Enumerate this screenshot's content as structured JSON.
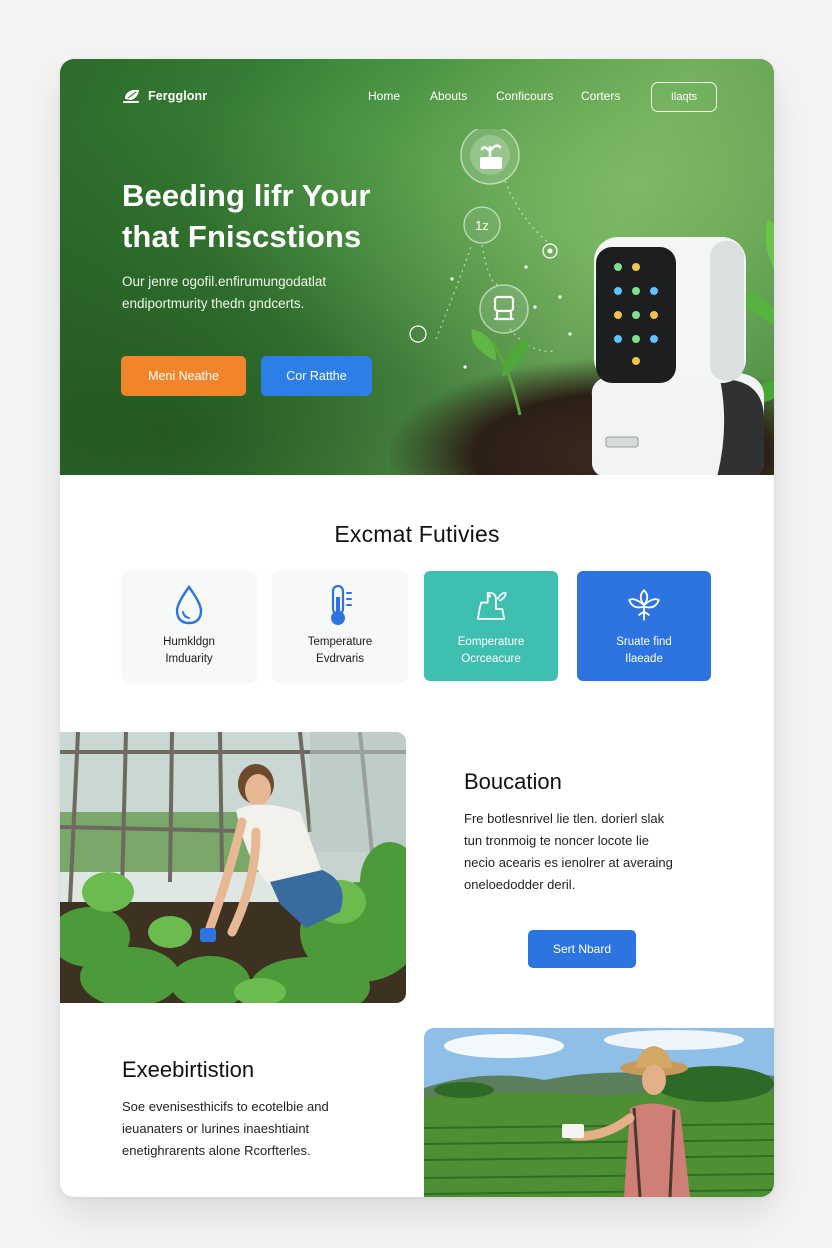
{
  "brand": {
    "name": "Fergglonr"
  },
  "nav": {
    "links": [
      "Home",
      "Abouts",
      "Conficours",
      "Corters"
    ],
    "cta": "Ilaqts"
  },
  "hero": {
    "title_line1": "Beeding lifr Your",
    "title_line2": "that Fniscstions",
    "text_line1": "Our jenre ogofil.enfirumungodatlat",
    "text_line2": "endiportmurity thedn gndcerts.",
    "primary_button": "Meni Neathe",
    "secondary_button": "Cor Ratthe",
    "device_badge": "1z"
  },
  "features": {
    "title": "Excmat Futivies",
    "items": [
      {
        "icon": "water-drop-icon",
        "line1": "Humkldgn",
        "line2": "Imduarity",
        "style": "light"
      },
      {
        "icon": "thermometer-icon",
        "line1": "Temperature",
        "line2": "Evdrvaris",
        "style": "light"
      },
      {
        "icon": "sprout-sensor-icon",
        "line1": "Eomperature",
        "line2": "Ocrceacure",
        "style": "teal",
        "color": "#3ebfb0"
      },
      {
        "icon": "leaf-cluster-icon",
        "line1": "Sruate find",
        "line2": "Ilaeade",
        "style": "blue",
        "color": "#2e74e0"
      }
    ]
  },
  "education": {
    "title": "Boucation",
    "lines": [
      "Fre botlesnrivel lie tlen. dorierl slak",
      "tun tronmoig te noncer locote lie",
      "necio acearis es ienolrer at averaing",
      "oneloedodder deril."
    ],
    "button": "Sert Nbard"
  },
  "exhibition": {
    "title": "Exeebirtistion",
    "lines": [
      "Soe evenisesthicifs to ecotelbie and",
      "ieuanaters or lurines inaeshtiaint",
      "enetighrarents alone Rcorfterles."
    ]
  },
  "colors": {
    "hero_green": "#3f8a3b",
    "accent_orange": "#f0852b",
    "accent_blue": "#2e7ee8",
    "teal": "#3ebfb0"
  }
}
